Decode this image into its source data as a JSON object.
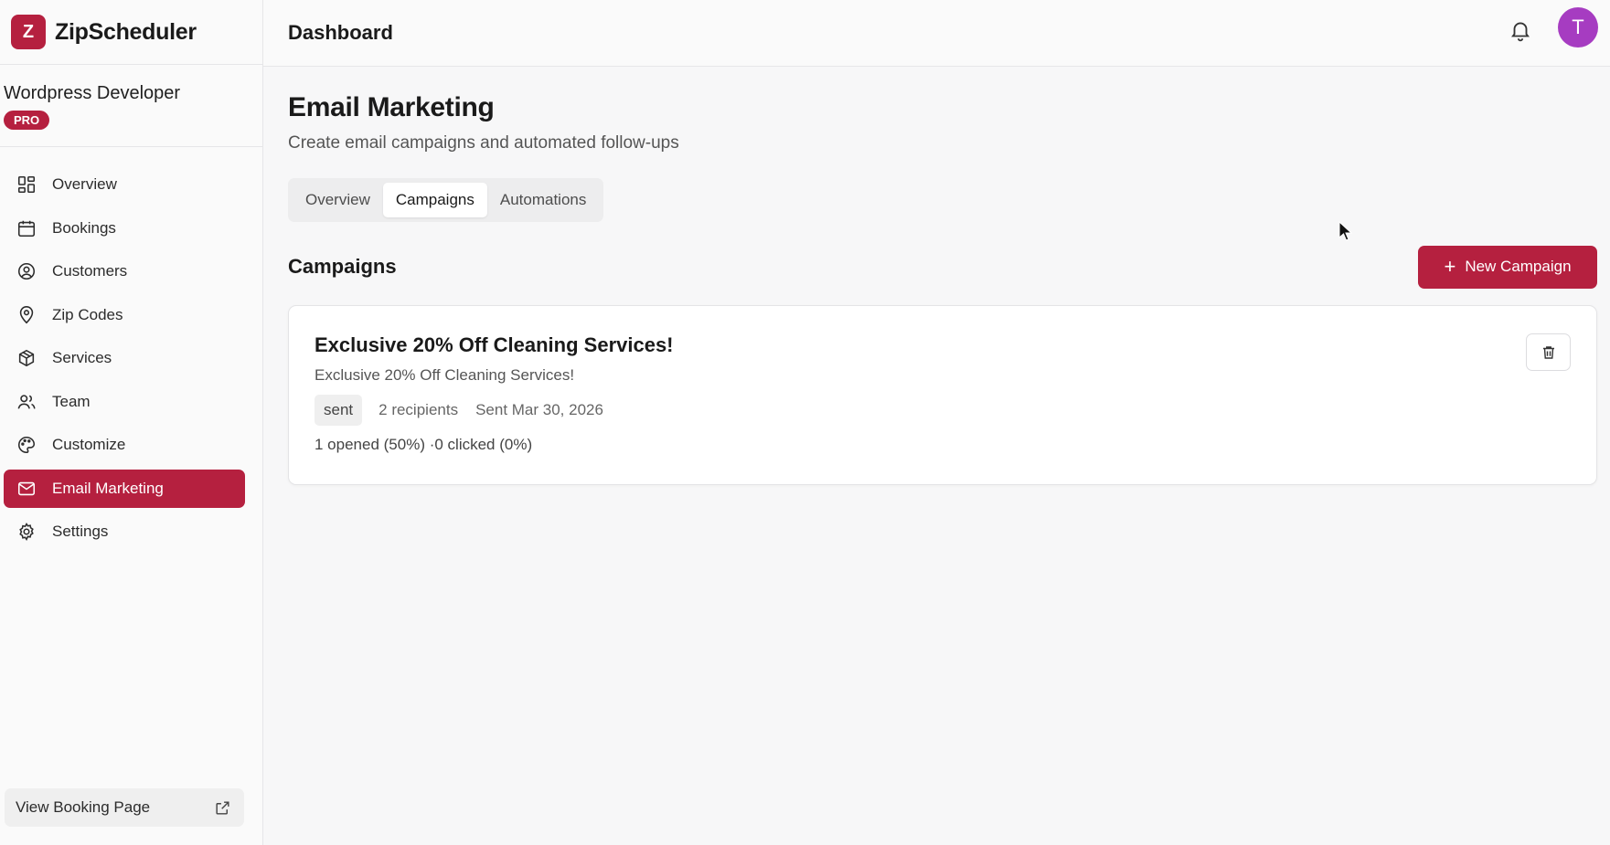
{
  "brand": {
    "logo_letter": "Z",
    "name": "ZipScheduler"
  },
  "workspace": {
    "name": "Wordpress Developer",
    "plan_badge": "PRO"
  },
  "sidebar": {
    "items": [
      {
        "label": "Overview",
        "icon": "grid-icon"
      },
      {
        "label": "Bookings",
        "icon": "calendar-icon"
      },
      {
        "label": "Customers",
        "icon": "user-circle-icon"
      },
      {
        "label": "Zip Codes",
        "icon": "map-pin-icon"
      },
      {
        "label": "Services",
        "icon": "package-icon"
      },
      {
        "label": "Team",
        "icon": "users-icon"
      },
      {
        "label": "Customize",
        "icon": "palette-icon"
      },
      {
        "label": "Email Marketing",
        "icon": "mail-icon",
        "active": true
      },
      {
        "label": "Settings",
        "icon": "gear-icon"
      }
    ],
    "footer_link": "View Booking Page"
  },
  "header": {
    "title": "Dashboard",
    "avatar_initial": "T"
  },
  "page": {
    "title": "Email Marketing",
    "subtitle": "Create email campaigns and automated follow-ups",
    "tabs": [
      {
        "label": "Overview"
      },
      {
        "label": "Campaigns",
        "active": true
      },
      {
        "label": "Automations"
      }
    ]
  },
  "campaigns": {
    "section_title": "Campaigns",
    "new_button_label": "New Campaign",
    "items": [
      {
        "title": "Exclusive 20% Off Cleaning Services!",
        "subject": "Exclusive 20% Off Cleaning Services!",
        "status": "sent",
        "recipients": "2 recipients",
        "sent_date": "Sent Mar 30, 2026",
        "stats": "1 opened (50%) ·0 clicked (0%)"
      }
    ]
  },
  "colors": {
    "accent": "#b5203f",
    "avatar": "#a63cc1"
  }
}
